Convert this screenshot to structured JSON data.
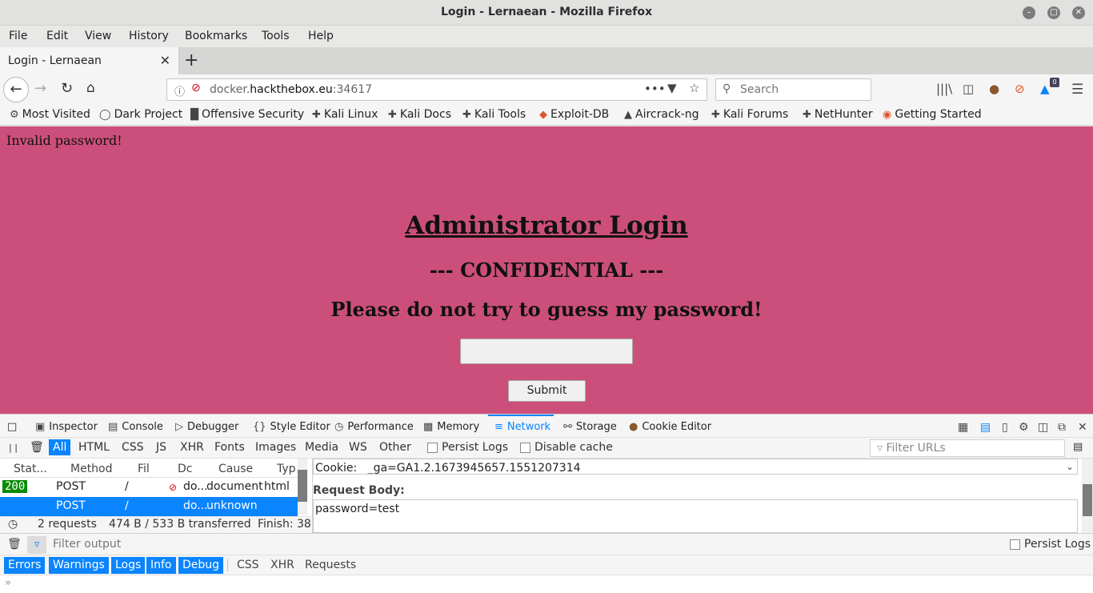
{
  "window": {
    "title": "Login - Lernaean - Mozilla Firefox"
  },
  "menu": [
    "File",
    "Edit",
    "View",
    "History",
    "Bookmarks",
    "Tools",
    "Help"
  ],
  "tab": {
    "title": "Login - Lernaean"
  },
  "nav": {
    "url_host_prefix": "docker.",
    "url_domain": "hackthebox.eu",
    "url_port": ":34617",
    "search_placeholder": "Search",
    "notification_count": "0"
  },
  "bookmarks": [
    "Most Visited",
    "Dark Project",
    "Offensive Security",
    "Kali Linux",
    "Kali Docs",
    "Kali Tools",
    "Exploit-DB",
    "Aircrack-ng",
    "Kali Forums",
    "NetHunter",
    "Getting Started"
  ],
  "page": {
    "message": "Invalid password!",
    "heading": "Administrator Login",
    "subheading": "--- CONFIDENTIAL ---",
    "warning": "Please do not try to guess my password!",
    "submit_label": "Submit",
    "background_color": "#cc4f7b"
  },
  "devtools": {
    "tabs": [
      "Inspector",
      "Console",
      "Debugger",
      "Style Editor",
      "Performance",
      "Memory",
      "Network",
      "Storage",
      "Cookie Editor"
    ],
    "active_tab": "Network",
    "filters": [
      "All",
      "HTML",
      "CSS",
      "JS",
      "XHR",
      "Fonts",
      "Images",
      "Media",
      "WS",
      "Other"
    ],
    "persist_logs": "Persist Logs",
    "disable_cache": "Disable cache",
    "filter_urls_placeholder": "Filter URLs",
    "columns": [
      "Stat...",
      "Method",
      "Fil",
      "Dc",
      "Cause",
      "Typ"
    ],
    "requests": [
      {
        "status": "200",
        "method": "POST",
        "file": "/",
        "domain": "do...",
        "cause": "document",
        "type": "html"
      },
      {
        "status": "",
        "method": "POST",
        "file": "/",
        "domain": "do...",
        "cause": "unknown",
        "type": ""
      }
    ],
    "summary": {
      "requests": "2 requests",
      "transferred": "474 B / 533 B transferred",
      "finish": "Finish: 38"
    },
    "details": {
      "cookie_label": "Cookie:",
      "cookie_value": "_ga=GA1.2.1673945657.1551207314",
      "request_body_title": "Request Body:",
      "request_body": "password=test"
    },
    "console": {
      "filter_placeholder": "Filter output",
      "persist_logs": "Persist Logs",
      "levels": [
        "Errors",
        "Warnings",
        "Logs",
        "Info",
        "Debug"
      ],
      "categories": [
        "CSS",
        "XHR",
        "Requests"
      ]
    }
  }
}
